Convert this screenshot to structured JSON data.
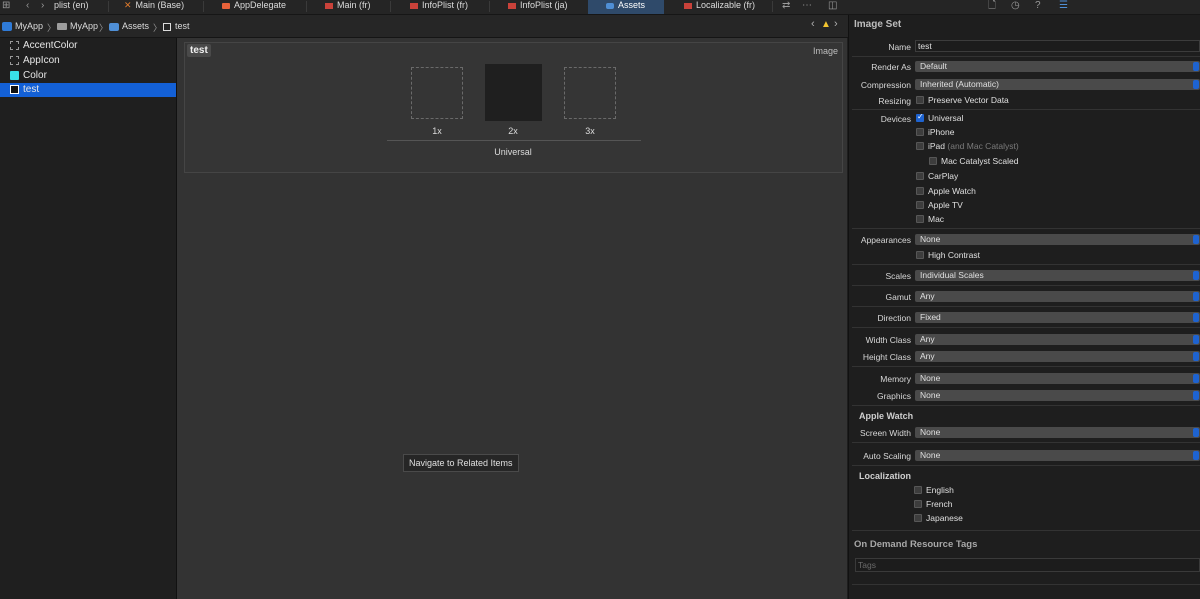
{
  "tabbar": {
    "tabs": [
      {
        "label": "plist (en)"
      },
      {
        "label": "Main (Base)"
      },
      {
        "label": "AppDelegate"
      },
      {
        "label": "Main (fr)"
      },
      {
        "label": "InfoPlist (fr)"
      },
      {
        "label": "InfoPlist (ja)"
      },
      {
        "label": "Assets"
      },
      {
        "label": "Localizable (fr)"
      }
    ]
  },
  "breadcrumb": {
    "items": [
      "MyApp",
      "MyApp",
      "Assets",
      "test"
    ]
  },
  "navigator": {
    "items": [
      {
        "label": "AccentColor",
        "swatch": "dashed"
      },
      {
        "label": "AppIcon",
        "swatch": "dashed"
      },
      {
        "label": "Color",
        "swatch": "#39e0e8"
      },
      {
        "label": "test",
        "swatch": "image"
      }
    ]
  },
  "editor": {
    "set_name": "test",
    "kind_label": "Image",
    "slots": [
      {
        "label": "1x",
        "filled": false
      },
      {
        "label": "2x",
        "filled": true
      },
      {
        "label": "3x",
        "filled": false
      }
    ],
    "group_label": "Universal",
    "tooltip": "Navigate to Related Items"
  },
  "inspector": {
    "title": "Image Set",
    "name_label": "Name",
    "name_value": "test",
    "render_as_label": "Render As",
    "render_as_value": "Default",
    "compression_label": "Compression",
    "compression_value": "Inherited (Automatic)",
    "resizing_label": "Resizing",
    "resizing_option": "Preserve Vector Data",
    "devices_label": "Devices",
    "devices": [
      {
        "label": "Universal",
        "checked": true
      },
      {
        "label": "iPhone",
        "checked": false
      },
      {
        "label": "iPad",
        "note": "(and Mac Catalyst)",
        "checked": false
      },
      {
        "label": "Mac Catalyst Scaled",
        "checked": false
      },
      {
        "label": "CarPlay",
        "checked": false
      },
      {
        "label": "Apple Watch",
        "checked": false
      },
      {
        "label": "Apple TV",
        "checked": false
      },
      {
        "label": "Mac",
        "checked": false
      }
    ],
    "appearances_label": "Appearances",
    "appearances_value": "None",
    "high_contrast": "High Contrast",
    "scales_label": "Scales",
    "scales_value": "Individual Scales",
    "gamut_label": "Gamut",
    "gamut_value": "Any",
    "direction_label": "Direction",
    "direction_value": "Fixed",
    "width_class_label": "Width Class",
    "width_class_value": "Any",
    "height_class_label": "Height Class",
    "height_class_value": "Any",
    "memory_label": "Memory",
    "memory_value": "None",
    "graphics_label": "Graphics",
    "graphics_value": "None",
    "apple_watch_title": "Apple Watch",
    "screen_width_label": "Screen Width",
    "screen_width_value": "None",
    "auto_scaling_label": "Auto Scaling",
    "auto_scaling_value": "None",
    "localization_title": "Localization",
    "languages": [
      "English",
      "French",
      "Japanese"
    ],
    "odr_title": "On Demand Resource Tags",
    "tags_placeholder": "Tags"
  },
  "colors": {
    "accent": "#1e63d0",
    "selection": "#1360d6",
    "active_tab": "#2f4a6a",
    "warning": "#f3c530",
    "color_swatch": "#39e0e8"
  }
}
